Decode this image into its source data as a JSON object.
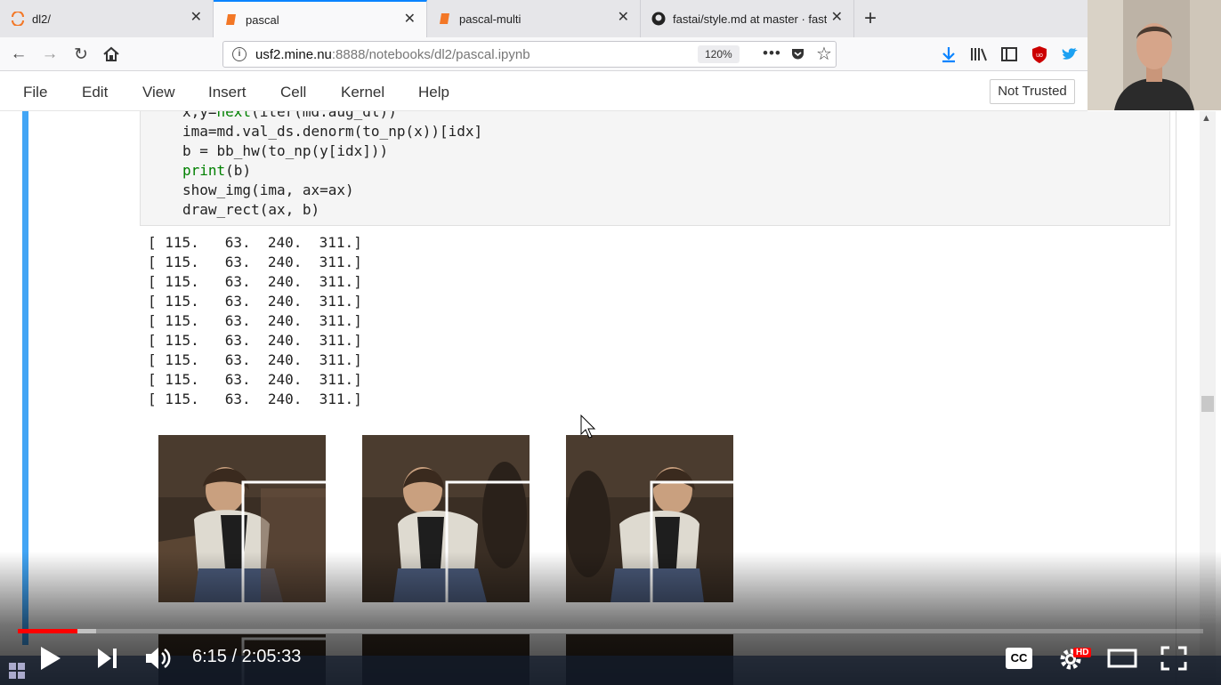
{
  "browser": {
    "tabs": [
      {
        "label": "dl2/",
        "active": false
      },
      {
        "label": "pascal",
        "active": true
      },
      {
        "label": "pascal-multi",
        "active": false
      },
      {
        "label": "fastai/style.md at master · fasta",
        "active": false
      }
    ],
    "url": {
      "host": "usf2.mine.nu",
      "path": ":8888/notebooks/dl2/pascal.ipynb"
    },
    "zoom": "120%"
  },
  "jupyter": {
    "menu": [
      "File",
      "Edit",
      "View",
      "Insert",
      "Cell",
      "Kernel",
      "Help"
    ],
    "trust_status": "Not Trusted"
  },
  "code_cell": {
    "lines": [
      {
        "plain": "x,y=",
        "kw": "next",
        "rest": "(iter(md.aug_dl))"
      },
      {
        "plain": "ima=md.val_ds.denorm(to_np(x))[idx]",
        "kw": "",
        "rest": ""
      },
      {
        "plain": "b = bb_hw(to_np(y[idx]))",
        "kw": "",
        "rest": ""
      },
      {
        "plain": "",
        "kw": "print",
        "rest": "(b)"
      },
      {
        "plain": "show_img(ima, ax=ax)",
        "kw": "",
        "rest": ""
      },
      {
        "plain": "draw_rect(ax, b)",
        "kw": "",
        "rest": ""
      }
    ]
  },
  "output": {
    "rows": [
      "[ 115.   63.  240.  311.]",
      "[ 115.   63.  240.  311.]",
      "[ 115.   63.  240.  311.]",
      "[ 115.   63.  240.  311.]",
      "[ 115.   63.  240.  311.]",
      "[ 115.   63.  240.  311.]",
      "[ 115.   63.  240.  311.]",
      "[ 115.   63.  240.  311.]",
      "[ 115.   63.  240.  311.]"
    ]
  },
  "video": {
    "time_current": "6:15",
    "time_total": "2:05:33",
    "time_display": "6:15 / 2:05:33",
    "progress_played_fraction": 0.05,
    "quality_badge": "HD",
    "cc_label": "CC"
  },
  "colors": {
    "accent": "#0a84ff",
    "cell_selected": "#42a5f5",
    "progress": "#ff0000"
  }
}
